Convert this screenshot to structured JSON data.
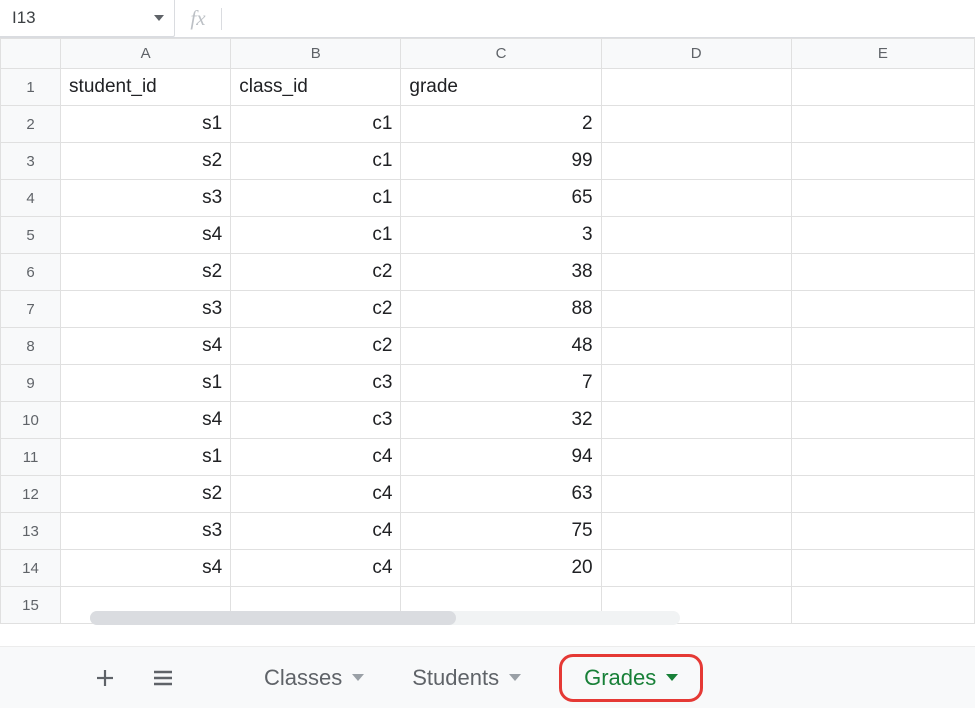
{
  "name_box": {
    "value": "I13"
  },
  "formula_bar": {
    "value": ""
  },
  "columns": [
    "A",
    "B",
    "C",
    "D",
    "E"
  ],
  "row_nums": [
    1,
    2,
    3,
    4,
    5,
    6,
    7,
    8,
    9,
    10,
    11,
    12,
    13,
    14,
    15
  ],
  "header_row": {
    "A": "student_id",
    "B": "class_id",
    "C": "grade"
  },
  "rows": [
    {
      "A": "s1",
      "B": "c1",
      "C": 2
    },
    {
      "A": "s2",
      "B": "c1",
      "C": 99
    },
    {
      "A": "s3",
      "B": "c1",
      "C": 65
    },
    {
      "A": "s4",
      "B": "c1",
      "C": 3
    },
    {
      "A": "s2",
      "B": "c2",
      "C": 38
    },
    {
      "A": "s3",
      "B": "c2",
      "C": 88
    },
    {
      "A": "s4",
      "B": "c2",
      "C": 48
    },
    {
      "A": "s1",
      "B": "c3",
      "C": 7
    },
    {
      "A": "s4",
      "B": "c3",
      "C": 32
    },
    {
      "A": "s1",
      "B": "c4",
      "C": 94
    },
    {
      "A": "s2",
      "B": "c4",
      "C": 63
    },
    {
      "A": "s3",
      "B": "c4",
      "C": 75
    },
    {
      "A": "s4",
      "B": "c4",
      "C": 20
    }
  ],
  "tabs": [
    {
      "label": "Classes",
      "active": false
    },
    {
      "label": "Students",
      "active": false
    },
    {
      "label": "Grades",
      "active": true
    }
  ],
  "icons": {
    "fx": "fx",
    "add_sheet": "plus-icon",
    "all_sheets": "all-sheets-icon",
    "name_box_caret": "chevron-down-icon",
    "tab_caret": "chevron-down-icon"
  }
}
